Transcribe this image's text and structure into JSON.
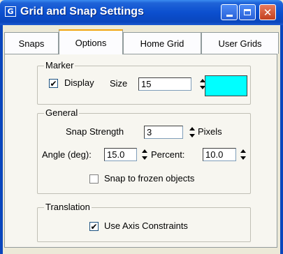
{
  "window": {
    "title": "Grid and Snap Settings",
    "icon_glyph": "G",
    "close_glyph": "✕"
  },
  "tabs": [
    {
      "label": "Snaps",
      "active": false
    },
    {
      "label": "Options",
      "active": true
    },
    {
      "label": "Home Grid",
      "active": false
    },
    {
      "label": "User Grids",
      "active": false
    }
  ],
  "marker": {
    "legend": "Marker",
    "display_label": "Display",
    "display_checked": true,
    "size_label": "Size",
    "size_value": "15",
    "color": "#00ffff"
  },
  "general": {
    "legend": "General",
    "snap_strength_label": "Snap Strength",
    "snap_strength_value": "3",
    "pixels_label": "Pixels",
    "angle_label": "Angle (deg):",
    "angle_value": "15.0",
    "percent_label": "Percent:",
    "percent_value": "10.0",
    "snap_frozen_label": "Snap to frozen objects",
    "snap_frozen_checked": false
  },
  "translation": {
    "legend": "Translation",
    "axis_constraints_label": "Use Axis Constraints",
    "axis_constraints_checked": true
  },
  "check_glyph": "✔"
}
